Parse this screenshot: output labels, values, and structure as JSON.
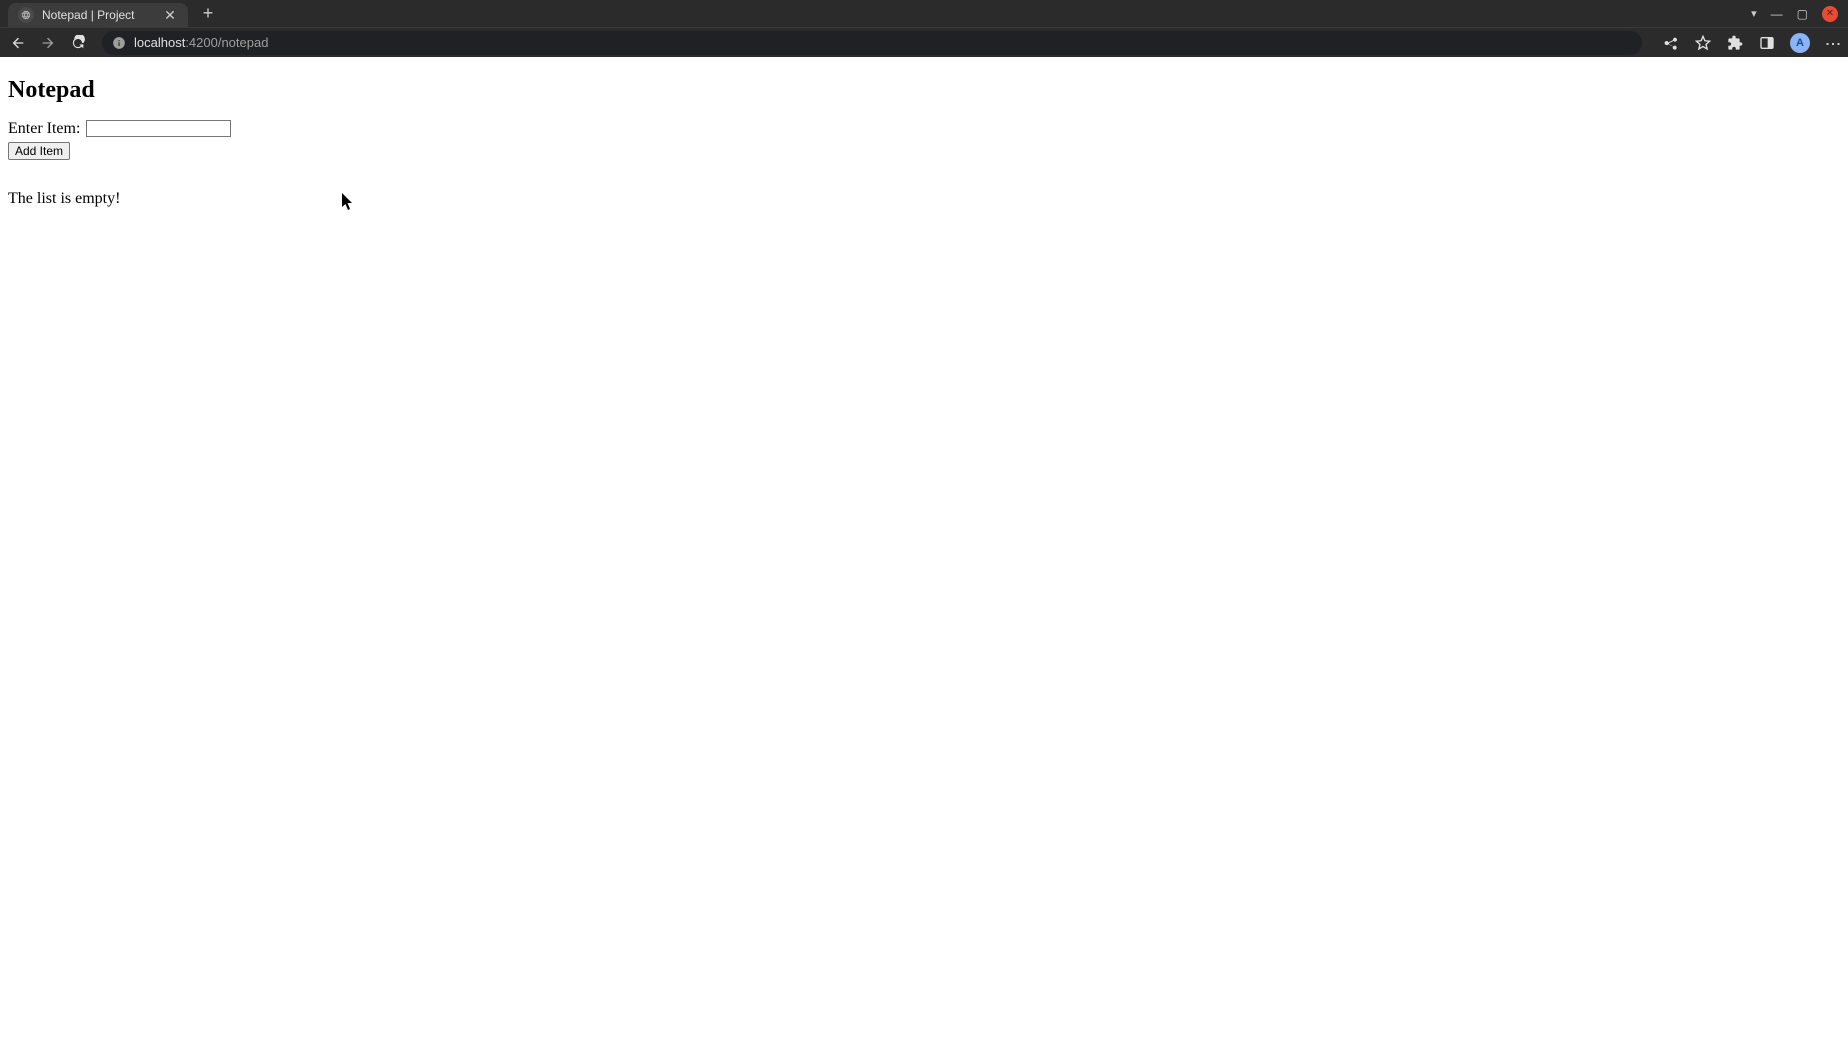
{
  "browser": {
    "tab_title": "Notepad | Project",
    "url_host": "localhost",
    "url_path": ":4200/notepad",
    "avatar_initial": "A"
  },
  "page": {
    "heading": "Notepad",
    "form": {
      "label": "Enter Item:",
      "input_value": "",
      "add_button_label": "Add Item"
    },
    "empty_message": "The list is empty!"
  }
}
